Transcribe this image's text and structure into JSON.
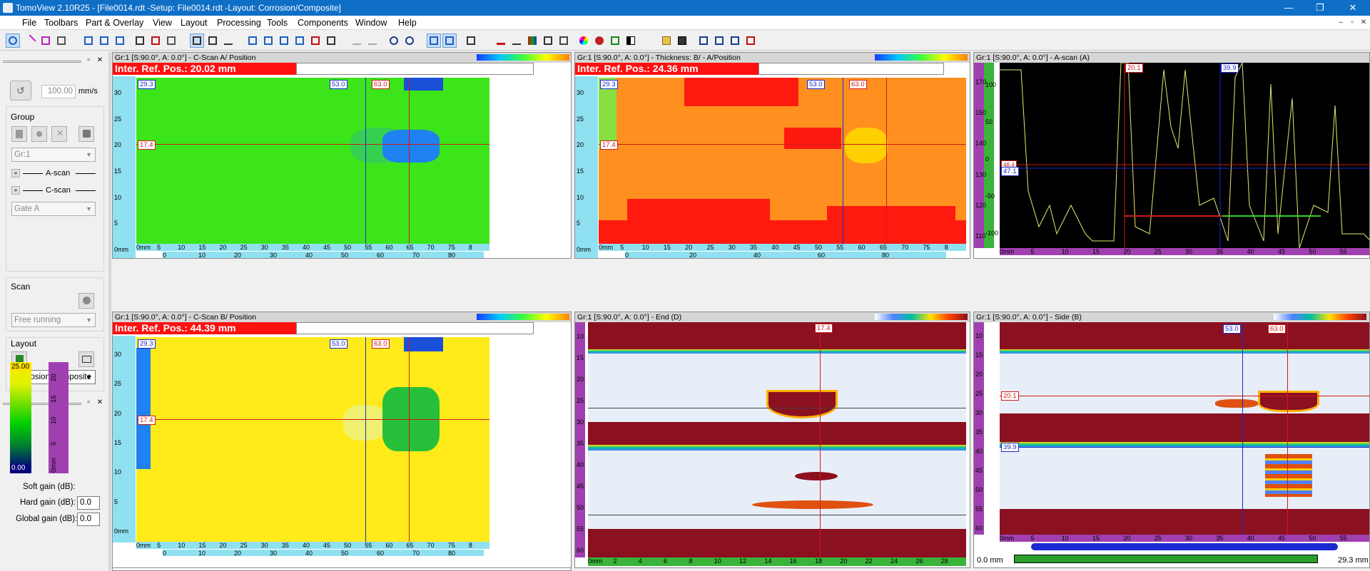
{
  "window": {
    "title": "TomoView 2.10R25 - [File0014.rdt -Setup: File0014.rdt -Layout: Corrosion/Composite]",
    "controls": {
      "minimize": "—",
      "restore": "❐",
      "close": "✕"
    }
  },
  "menu": {
    "items": [
      "File",
      "Toolbars",
      "Part & Overlay",
      "View",
      "Layout",
      "Processing",
      "Tools",
      "Components",
      "Window",
      "Help"
    ],
    "mdi": {
      "minimize": "–",
      "restore": "▫",
      "close": "✕"
    }
  },
  "left_panel": {
    "speed": {
      "value": "100.00",
      "unit": "mm/s"
    },
    "group": {
      "title": "Group",
      "selected": "Gr:1",
      "ascan_label": "A-scan",
      "cscan_label": "C-scan",
      "gate": "Gate A"
    },
    "scan": {
      "title": "Scan",
      "mode": "Free running"
    },
    "layout": {
      "title": "Layout",
      "selected": "Corrosion/Composite"
    },
    "palette": {
      "max": "25.00",
      "min": "0.00",
      "ticks": [
        "20",
        "15",
        "10",
        "5",
        "0mm"
      ]
    },
    "gains": {
      "soft_label": "Soft gain (dB):",
      "hard_label": "Hard gain (dB):",
      "hard_value": "0.0",
      "global_label": "Global gain (dB):",
      "global_value": "0.0"
    }
  },
  "views": {
    "cscan_a": {
      "header": "Gr:1 [S:90.0°, A: 0.0°] - C-Scan A/ Position",
      "ref": "Inter. Ref. Pos.: 20.02 mm",
      "tag_left": "29.3",
      "tag_b1": "53.0",
      "tag_b2": "63.0",
      "tag_row": "17.4"
    },
    "thickness": {
      "header": "Gr:1 [S:90.0°, A: 0.0°] - Thickness: B/ - A/Position",
      "ref": "Inter. Ref. Pos.: 24.36 mm",
      "tag_left": "29.3",
      "tag_b1": "53.0",
      "tag_b2": "63.0",
      "tag_row": "17.4"
    },
    "ascan": {
      "header": "Gr:1 [S:90.0°, A: 0.0°] - A-scan (A)",
      "tag_red": "20.1",
      "tag_blue": "39.9",
      "tag_row_red": "48.4",
      "tag_row_blue": "47.1"
    },
    "cscan_b": {
      "header": "Gr:1 [S:90.0°, A: 0.0°] - C-Scan B/ Position",
      "ref": "Inter. Ref. Pos.: 44.39 mm",
      "tag_left": "29.3",
      "tag_b1": "53.0",
      "tag_b2": "63.0",
      "tag_row": "17.4"
    },
    "end": {
      "header": "Gr:1 [S:90.0°, A: 0.0°] - End (D)",
      "tag_top": "17.4"
    },
    "side": {
      "header": "Gr:1 [S:90.0°, A: 0.0°] - Side (B)",
      "tag_b1": "53.0",
      "tag_b2": "63.0",
      "tag_red": "20.1",
      "tag_blue": "39.9"
    }
  },
  "scan_axis_ticks": [
    "0mm",
    "5",
    "10",
    "15",
    "20",
    "25",
    "30",
    "35",
    "40",
    "45",
    "50",
    "55",
    "60",
    "65",
    "70",
    "75",
    "8"
  ],
  "index_axis_ticks": [
    "0",
    "10",
    "20",
    "30",
    "40",
    "50",
    "60",
    "70",
    "80"
  ],
  "index_axis_ticks_coarse": [
    "0",
    "20",
    "40",
    "60",
    "80"
  ],
  "y_axis_ticks": [
    "0mm",
    "5",
    "10",
    "15",
    "20",
    "25",
    "30"
  ],
  "ascan_axis_ticks": [
    "0mm",
    "5",
    "10",
    "15",
    "20",
    "25",
    "30",
    "35",
    "40",
    "45",
    "50",
    "55"
  ],
  "end_axis_ticks": [
    "0mm",
    "2",
    "4",
    "6",
    "8",
    "10",
    "12",
    "14",
    "16",
    "18",
    "20",
    "22",
    "24",
    "26",
    "28"
  ],
  "status": {
    "left": "0.0 mm",
    "right": "29.3 mm"
  },
  "ascan_amp_ticks": [
    "100",
    "50",
    "0",
    "-50",
    "-100"
  ],
  "ascan_time_ticks": [
    "170",
    "150",
    "140",
    "130",
    "120",
    "110"
  ],
  "depth_ticks": [
    "10",
    "15",
    "20",
    "25",
    "30",
    "35",
    "40",
    "45",
    "50",
    "55",
    "60"
  ]
}
